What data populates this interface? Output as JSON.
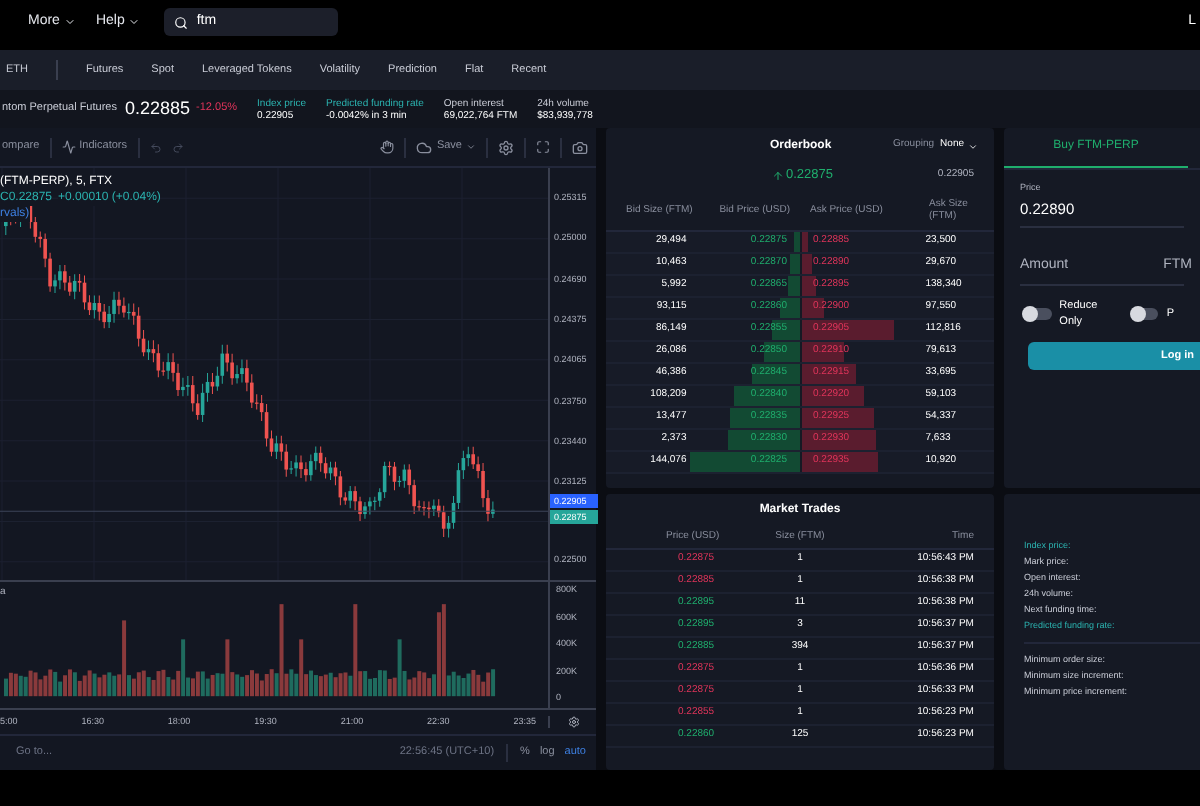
{
  "top_bar": {
    "menus": [
      {
        "label": "More"
      },
      {
        "label": "Help"
      }
    ],
    "search": {
      "value": "ftm"
    },
    "user_initial": "L"
  },
  "nav": {
    "items": [
      "ETH",
      "Futures",
      "Spot",
      "Leveraged Tokens",
      "Volatility",
      "Prediction",
      "Flat",
      "Recent"
    ]
  },
  "ticker": {
    "name": "ntom Perpetual Futures",
    "price": "0.22885",
    "change": "-12.05%",
    "stats": [
      {
        "label": "Index price",
        "value": "0.22905",
        "highlighted": true
      },
      {
        "label": "Predicted funding rate",
        "value": "-0.0042% in 3 min",
        "highlighted": true
      },
      {
        "label": "Open interest",
        "value": "69,022,764 FTM",
        "highlighted": false
      },
      {
        "label": "24h volume",
        "value": "$83,939,778",
        "highlighted": false
      }
    ]
  },
  "chart": {
    "toolbar": {
      "compare": "ompare",
      "indicators": "Indicators",
      "save": "Save"
    },
    "legend": {
      "symbol": "(FTM-PERP), 5, FTX",
      "close": "C0.22875",
      "change": "+0.00010 (+0.04%)",
      "note": "rvals)"
    },
    "price_ticks": [
      "0.25315",
      "0.25000",
      "0.24690",
      "0.24375",
      "0.24065",
      "0.23750",
      "0.23440",
      "0.23125",
      "0.22500"
    ],
    "price_tags": [
      {
        "value": "0.22905",
        "kind": "index"
      },
      {
        "value": "0.22875",
        "kind": "last"
      }
    ],
    "volume_label": "a",
    "volume_ticks": [
      "800K",
      "600K",
      "400K",
      "200K",
      "0"
    ],
    "time_ticks": [
      "5:00",
      "16:30",
      "18:00",
      "19:30",
      "21:00",
      "22:30",
      "23:35"
    ],
    "footer": {
      "goto": "Go to...",
      "clock": "22:56:45 (UTC+10)",
      "options": [
        {
          "label": "%",
          "selected": false
        },
        {
          "label": "log",
          "selected": false
        },
        {
          "label": "auto",
          "selected": true
        }
      ]
    }
  },
  "orderbook": {
    "title": "Orderbook",
    "grouping_label": "Grouping",
    "grouping_value": "None",
    "last_price": "0.22875",
    "rising": true,
    "mark_price": "0.22905",
    "columns": [
      "Bid Size (FTM)",
      "Bid Price (USD)",
      "Ask Price (USD)",
      "Ask Size (FTM)"
    ],
    "rows": [
      {
        "bid": {
          "size": "29,494",
          "price": "0.22875",
          "level": 0.03
        },
        "ask": {
          "price": "0.22885",
          "size": "23,500",
          "level": 0.04
        }
      },
      {
        "bid": {
          "size": "10,463",
          "price": "0.22870",
          "level": 0.05
        },
        "ask": {
          "price": "0.22890",
          "size": "29,670",
          "level": 0.06
        }
      },
      {
        "bid": {
          "size": "5,992",
          "price": "0.22865",
          "level": 0.06
        },
        "ask": {
          "price": "0.22895",
          "size": "138,340",
          "level": 0.08
        }
      },
      {
        "bid": {
          "size": "93,115",
          "price": "0.22860",
          "level": 0.1
        },
        "ask": {
          "price": "0.22900",
          "size": "97,550",
          "level": 0.12
        }
      },
      {
        "bid": {
          "size": "86,149",
          "price": "0.22855",
          "level": 0.14
        },
        "ask": {
          "price": "0.22905",
          "size": "112,816",
          "level": 0.48
        }
      },
      {
        "bid": {
          "size": "26,086",
          "price": "0.22850",
          "level": 0.18
        },
        "ask": {
          "price": "0.22910",
          "size": "79,613",
          "level": 0.22
        }
      },
      {
        "bid": {
          "size": "46,386",
          "price": "0.22845",
          "level": 0.24
        },
        "ask": {
          "price": "0.22915",
          "size": "33,695",
          "level": 0.28
        }
      },
      {
        "bid": {
          "size": "108,209",
          "price": "0.22840",
          "level": 0.34
        },
        "ask": {
          "price": "0.22920",
          "size": "59,103",
          "level": 0.33
        }
      },
      {
        "bid": {
          "size": "13,477",
          "price": "0.22835",
          "level": 0.36
        },
        "ask": {
          "price": "0.22925",
          "size": "54,337",
          "level": 0.38
        }
      },
      {
        "bid": {
          "size": "2,373",
          "price": "0.22830",
          "level": 0.37
        },
        "ask": {
          "price": "0.22930",
          "size": "7,633",
          "level": 0.39
        }
      },
      {
        "bid": {
          "size": "144,076",
          "price": "0.22825",
          "level": 0.56
        },
        "ask": {
          "price": "0.22935",
          "size": "10,920",
          "level": 0.4
        }
      }
    ]
  },
  "trades": {
    "title": "Market Trades",
    "columns": [
      "Price (USD)",
      "Size (FTM)",
      "Time"
    ],
    "rows": [
      {
        "price": "0.22875",
        "size": "1",
        "time": "10:56:43 PM",
        "kind": "sell"
      },
      {
        "price": "0.22885",
        "size": "1",
        "time": "10:56:38 PM",
        "kind": "sell"
      },
      {
        "price": "0.22895",
        "size": "11",
        "time": "10:56:38 PM",
        "kind": "buy"
      },
      {
        "price": "0.22895",
        "size": "3",
        "time": "10:56:37 PM",
        "kind": "buy"
      },
      {
        "price": "0.22885",
        "size": "394",
        "time": "10:56:37 PM",
        "kind": "buy"
      },
      {
        "price": "0.22875",
        "size": "1",
        "time": "10:56:36 PM",
        "kind": "sell"
      },
      {
        "price": "0.22875",
        "size": "1",
        "time": "10:56:33 PM",
        "kind": "sell"
      },
      {
        "price": "0.22855",
        "size": "1",
        "time": "10:56:23 PM",
        "kind": "sell"
      },
      {
        "price": "0.22860",
        "size": "125",
        "time": "10:56:23 PM",
        "kind": "buy"
      }
    ]
  },
  "order_form": {
    "tabs": [
      {
        "label": "Buy FTM-PERP",
        "selected": true
      }
    ],
    "price": {
      "label": "Price",
      "value": "0.22890"
    },
    "amount": {
      "label": "Amount",
      "unit": "FTM"
    },
    "toggles": [
      {
        "label": "Reduce Only",
        "on": false
      },
      {
        "label": "P",
        "on": false
      }
    ],
    "login": "Log in"
  },
  "info": {
    "groups": [
      [
        {
          "label": "Index price:",
          "highlighted": true
        },
        {
          "label": "Mark price:",
          "highlighted": false
        },
        {
          "label": "Open interest:",
          "highlighted": false
        },
        {
          "label": "24h volume:",
          "highlighted": false
        },
        {
          "label": "Next funding time:",
          "highlighted": false
        },
        {
          "label": "Predicted funding rate:",
          "highlighted": true
        }
      ],
      [
        {
          "label": "Minimum order size:",
          "highlighted": false
        },
        {
          "label": "Minimum size increment:",
          "highlighted": false
        },
        {
          "label": "Minimum price increment:",
          "highlighted": false
        }
      ]
    ]
  }
}
